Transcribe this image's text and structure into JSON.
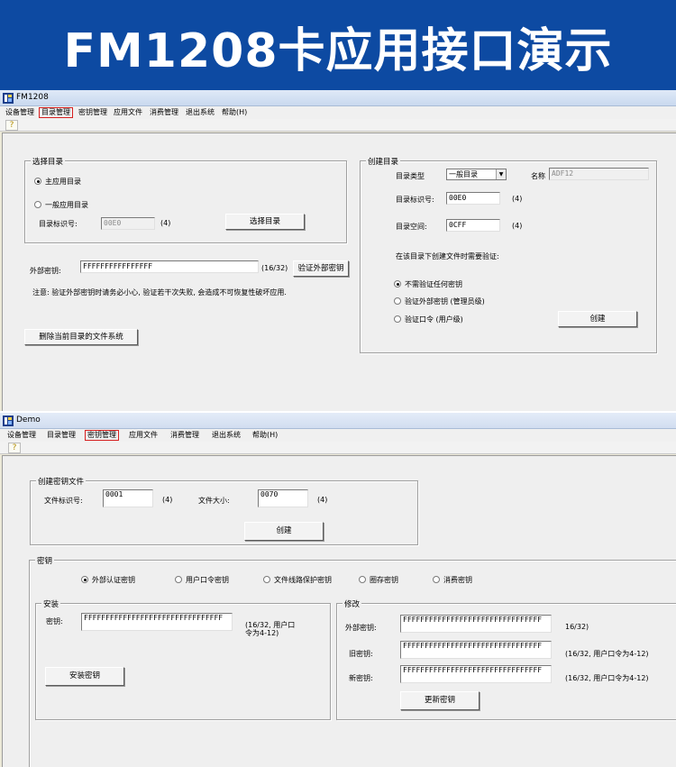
{
  "banner": {
    "title": "FM1208卡应用接口演示"
  },
  "colors": {
    "banner": "#0d4aa2",
    "menu_highlight": "#d62020"
  },
  "win1": {
    "title": "FM1208",
    "menu": [
      "设备管理",
      "目录管理",
      "密钥管理",
      "应用文件",
      "消费管理",
      "退出系统",
      "帮助(H)"
    ],
    "toolbar_icon": "key-icon",
    "select_dir": {
      "label": "选择目录",
      "opt_main": "主应用目录",
      "opt_normal": "一般应用目录",
      "id_label": "目录标识号:",
      "id_value": "00E0",
      "id_hint": "(4)",
      "button": "选择目录"
    },
    "ext_key": {
      "label": "外部密钥:",
      "value": "FFFFFFFFFFFFFFFF",
      "hint": "(16/32)",
      "button": "验证外部密钥",
      "note": "注意: 验证外部密钥时请务必小心, 验证若干次失败, 会造成不可恢复性破坏应用."
    },
    "delete_button": "删除当前目录的文件系统",
    "create_dir": {
      "label": "创建目录",
      "type_label": "目录类型",
      "type_value": "一般目录",
      "name_label": "名称",
      "name_value": "ADF12",
      "id_label": "目录标识号:",
      "id_value": "00E0",
      "id_hint": "(4)",
      "space_label": "目录空间:",
      "space_value": "0CFF",
      "space_hint": "(4)",
      "verify_prompt": "在该目录下创建文件时需要验证:",
      "opt_none": "不需验证任何密钥",
      "opt_ext": "验证外部密钥 (管理员级)",
      "opt_pin": "验证口令 (用户级)",
      "button": "创建"
    }
  },
  "win2": {
    "title": "Demo",
    "menu": [
      "设备管理",
      "目录管理",
      "密钥管理",
      "应用文件",
      "消费管理",
      "退出系统",
      "帮助(H)"
    ],
    "toolbar_icon": "key-icon",
    "create_key_file": {
      "label": "创建密钥文件",
      "id_label": "文件标识号:",
      "id_value": "0001",
      "id_hint": "(4)",
      "size_label": "文件大小:",
      "size_value": "0070",
      "size_hint": "(4)",
      "button": "创建"
    },
    "keys": {
      "label": "密钥",
      "opt_ext": "外部认证密钥",
      "opt_pin": "用户口令密钥",
      "opt_line": "文件线路保护密钥",
      "opt_load": "圈存密钥",
      "opt_purchase": "消费密钥"
    },
    "install": {
      "label": "安装",
      "key_label": "密钥:",
      "key_value": "FFFFFFFFFFFFFFFFFFFFFFFFFFFFFFFF",
      "hint_line1": "(16/32, 用户口",
      "hint_line2": "令为4-12)",
      "button": "安装密钥"
    },
    "modify": {
      "label": "修改",
      "ext_label": "外部密钥:",
      "ext_value": "FFFFFFFFFFFFFFFFFFFFFFFFFFFFFFFF",
      "ext_hint": "16/32)",
      "old_label": "旧密钥:",
      "old_value": "FFFFFFFFFFFFFFFFFFFFFFFFFFFFFFFF",
      "old_hint": "(16/32, 用户口令为4-12)",
      "new_label": "新密钥:",
      "new_value": "FFFFFFFFFFFFFFFFFFFFFFFFFFFFFFFF",
      "new_hint": "(16/32, 用户口令为4-12)",
      "button": "更新密钥"
    }
  }
}
